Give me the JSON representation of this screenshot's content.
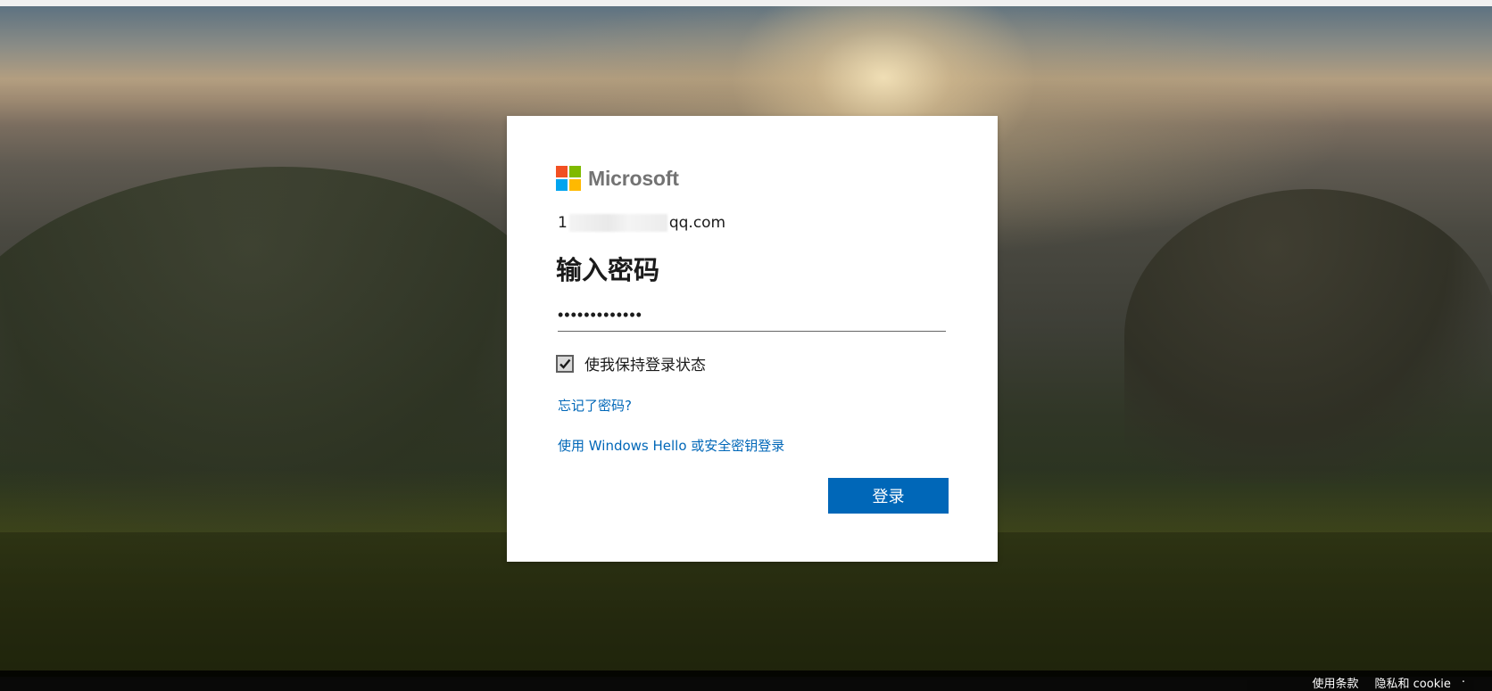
{
  "login": {
    "brand": "Microsoft",
    "identity_prefix": "1",
    "identity_suffix": "qq.com",
    "title": "输入密码",
    "password_value": "•••••••••••••",
    "keep_signed_in_label": "使我保持登录状态",
    "keep_signed_in_checked": true,
    "forgot_password_link": "忘记了密码?",
    "windows_hello_link": "使用 Windows Hello 或安全密钥登录",
    "signin_button": "登录"
  },
  "footer": {
    "terms": "使用条款",
    "privacy": "隐私和 cookie",
    "more": "·"
  },
  "colors": {
    "accent": "#0067b8",
    "logo_red": "#f25022",
    "logo_green": "#7fba00",
    "logo_blue": "#00a4ef",
    "logo_yellow": "#ffb900"
  }
}
